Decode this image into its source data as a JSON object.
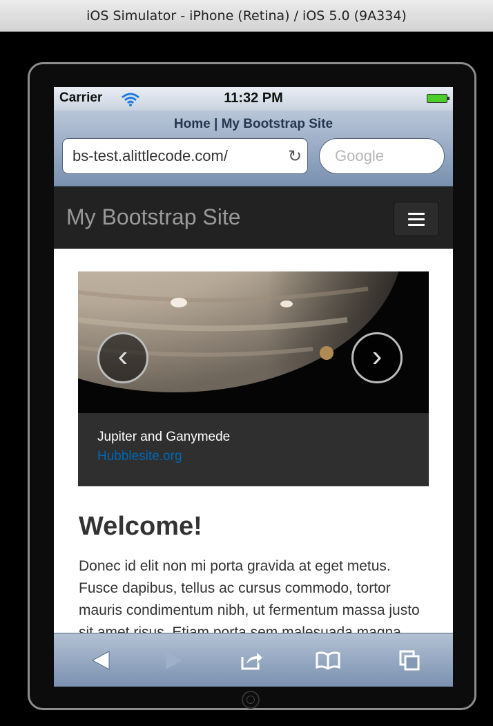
{
  "simulator": {
    "title": "iOS Simulator - iPhone (Retina) / iOS 5.0 (9A334)"
  },
  "status_bar": {
    "carrier": "Carrier",
    "time": "11:32 PM",
    "wifi_icon": "wifi-icon",
    "battery_icon": "battery-icon"
  },
  "safari": {
    "page_title": "Home | My Bootstrap Site",
    "address": "bs-test.alittlecode.com/",
    "reload_icon": "↻",
    "search_placeholder": "Google"
  },
  "navbar": {
    "brand": "My Bootstrap Site",
    "toggle_icon": "hamburger-icon"
  },
  "carousel": {
    "caption_title": "Jupiter and Ganymede",
    "caption_link": "Hubblesite.org",
    "prev_label": "‹",
    "next_label": "›"
  },
  "content": {
    "heading": "Welcome!",
    "paragraph": "Donec id elit non mi porta gravida at eget metus. Fusce dapibus, tellus ac cursus commodo, tortor mauris condimentum nibh, ut fermentum massa justo sit amet risus. Etiam porta sem malesuada magna mollis euismod."
  },
  "toolbar": {
    "icons": [
      "back-arrow-icon",
      "forward-arrow-icon",
      "share-icon",
      "bookmarks-icon",
      "tabs-icon"
    ]
  },
  "colors": {
    "navbar_bg": "#222222",
    "link": "#0066b3",
    "caption_bg": "#333333",
    "battery": "#4ccd2c"
  }
}
